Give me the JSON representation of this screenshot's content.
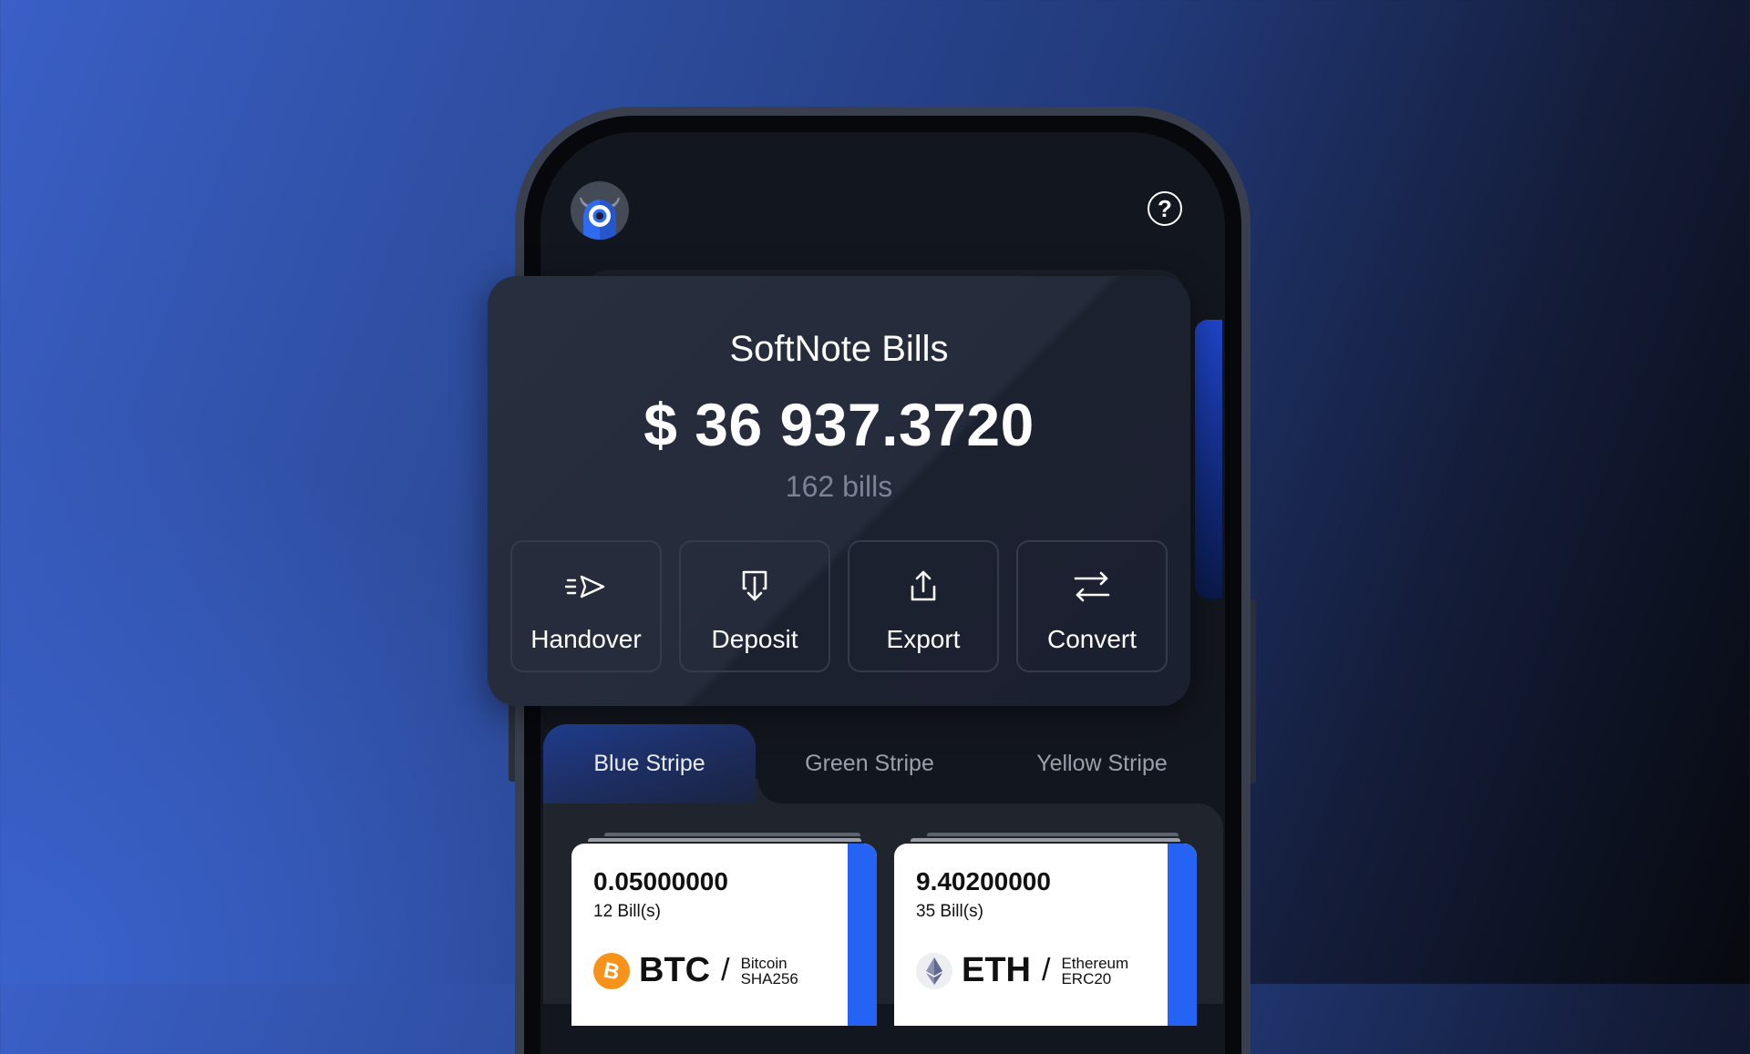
{
  "header": {
    "avatar_icon": "monster-avatar-icon",
    "help_icon": "question-circle-icon",
    "help_glyph": "?"
  },
  "balance": {
    "title": "SoftNote Bills",
    "amount": "$ 36 937.3720",
    "count": "162 bills"
  },
  "actions": [
    {
      "label": "Handover",
      "icon": "send-fast-icon"
    },
    {
      "label": "Deposit",
      "icon": "deposit-arrow-down-icon"
    },
    {
      "label": "Export",
      "icon": "share-upload-icon"
    },
    {
      "label": "Convert",
      "icon": "swap-arrows-icon"
    }
  ],
  "tabs": [
    {
      "label": "Blue Stripe",
      "active": true
    },
    {
      "label": "Green Stripe",
      "active": false
    },
    {
      "label": "Yellow Stripe",
      "active": false
    }
  ],
  "bills": [
    {
      "amount": "0.05000000",
      "count": "12 Bill(s)",
      "ticker": "BTC",
      "name": "Bitcoin",
      "algo": "SHA256",
      "icon": "bitcoin-icon",
      "color": "#f7931a"
    },
    {
      "amount": "9.40200000",
      "count": "35 Bill(s)",
      "ticker": "ETH",
      "name": "Ethereum",
      "algo": "ERC20",
      "icon": "ethereum-icon",
      "color": "#627eea"
    }
  ],
  "colors": {
    "accent": "#2563f5",
    "card_bg": "#242a39",
    "screen_bg": "#12161e",
    "muted_text": "#7b8496"
  },
  "slash": "/"
}
